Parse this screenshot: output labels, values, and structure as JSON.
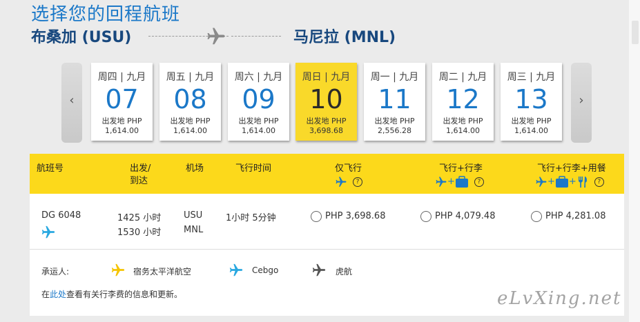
{
  "header": {
    "title": "选择您的回程航班",
    "origin": "布桑加 (USU)",
    "destination": "马尼拉 (MNL)"
  },
  "dates": [
    {
      "label": "周四 | 九月",
      "day": "07",
      "price_label": "出发地 PHP",
      "price": "1,614.00",
      "selected": false
    },
    {
      "label": "周五 | 九月",
      "day": "08",
      "price_label": "出发地 PHP",
      "price": "1,614.00",
      "selected": false
    },
    {
      "label": "周六 | 九月",
      "day": "09",
      "price_label": "出发地 PHP",
      "price": "1,614.00",
      "selected": false
    },
    {
      "label": "周日 | 九月",
      "day": "10",
      "price_label": "出发地 PHP",
      "price": "3,698.68",
      "selected": true
    },
    {
      "label": "周一 | 九月",
      "day": "11",
      "price_label": "出发地 PHP",
      "price": "2,556.28",
      "selected": false
    },
    {
      "label": "周二 | 九月",
      "day": "12",
      "price_label": "出发地 PHP",
      "price": "1,614.00",
      "selected": false
    },
    {
      "label": "周三 | 九月",
      "day": "13",
      "price_label": "出发地 PHP",
      "price": "1,614.00",
      "selected": false
    }
  ],
  "table": {
    "headers": {
      "flight_no": "航班号",
      "depart": "出发/",
      "arrive": "到达",
      "airport": "机场",
      "duration": "飞行时间",
      "fare1": "仅飞行",
      "fare2": "飞行+行李",
      "fare3": "飞行+行李+用餐",
      "help": "?"
    },
    "row": {
      "flight_no": "DG 6048",
      "depart_time": "1425 小时",
      "arrive_time": "1530 小时",
      "depart_airport": "USU",
      "arrive_airport": "MNL",
      "duration": "1小时 5分钟",
      "fare1": "PHP 3,698.68",
      "fare2": "PHP 4,079.48",
      "fare3": "PHP 4,281.08"
    }
  },
  "carriers": {
    "label": "承运人:",
    "items": [
      {
        "name": "宿务太平洋航空",
        "color": "#f5c400"
      },
      {
        "name": "Cebgo",
        "color": "#29a8e0"
      },
      {
        "name": "虎航",
        "color": "#555555"
      }
    ],
    "note_prefix": "在",
    "note_link": "此处",
    "note_suffix": "查看有关行李费的信息和更新。"
  },
  "watermark": "eLvXing.net",
  "colors": {
    "accent_blue": "#1b78c8",
    "navy": "#18487e",
    "yellow": "#fcd91b",
    "selected_card": "#f9d92a"
  }
}
